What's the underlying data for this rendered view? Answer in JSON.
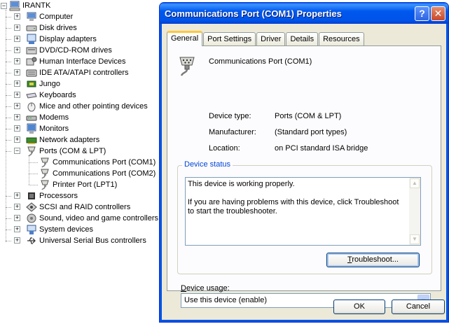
{
  "tree": {
    "root": "IRANTK",
    "items": [
      {
        "label": "Computer",
        "icon": "computer-icon"
      },
      {
        "label": "Disk drives",
        "icon": "disk-drive-icon"
      },
      {
        "label": "Display adapters",
        "icon": "display-adapter-icon"
      },
      {
        "label": "DVD/CD-ROM drives",
        "icon": "cdrom-icon"
      },
      {
        "label": "Human Interface Devices",
        "icon": "hid-icon"
      },
      {
        "label": "IDE ATA/ATAPI controllers",
        "icon": "ide-controller-icon"
      },
      {
        "label": "Jungo",
        "icon": "chip-icon"
      },
      {
        "label": "Keyboards",
        "icon": "keyboard-icon"
      },
      {
        "label": "Mice and other pointing devices",
        "icon": "mouse-icon"
      },
      {
        "label": "Modems",
        "icon": "modem-icon"
      },
      {
        "label": "Monitors",
        "icon": "monitor-icon"
      },
      {
        "label": "Network adapters",
        "icon": "network-adapter-icon"
      },
      {
        "label": "Ports (COM & LPT)",
        "icon": "port-icon",
        "expanded": true
      },
      {
        "label": "Communications Port (COM1)",
        "icon": "port-icon",
        "child": true
      },
      {
        "label": "Communications Port (COM2)",
        "icon": "port-icon",
        "child": true
      },
      {
        "label": "Printer Port (LPT1)",
        "icon": "port-icon",
        "child": true
      },
      {
        "label": "Processors",
        "icon": "processor-icon"
      },
      {
        "label": "SCSI and RAID controllers",
        "icon": "scsi-icon"
      },
      {
        "label": "Sound, video and game controllers",
        "icon": "sound-icon"
      },
      {
        "label": "System devices",
        "icon": "system-device-icon"
      },
      {
        "label": "Universal Serial Bus controllers",
        "icon": "usb-icon"
      }
    ]
  },
  "dialog": {
    "title": "Communications Port (COM1) Properties",
    "help_glyph": "?",
    "close_glyph": "✕",
    "tabs": [
      {
        "label": "General",
        "active": true
      },
      {
        "label": "Port Settings"
      },
      {
        "label": "Driver"
      },
      {
        "label": "Details"
      },
      {
        "label": "Resources"
      }
    ],
    "device_name": "Communications Port (COM1)",
    "properties": [
      {
        "label": "Device type:",
        "value": "Ports (COM & LPT)"
      },
      {
        "label": "Manufacturer:",
        "value": "(Standard port types)"
      },
      {
        "label": "Location:",
        "value": "on PCI standard ISA bridge"
      }
    ],
    "status_group_title": "Device status",
    "status_lines": [
      "This device is working properly.",
      "If you are having problems with this device, click Troubleshoot to start the troubleshooter."
    ],
    "troubleshoot": {
      "mnemonic": "T",
      "rest": "roubleshoot..."
    },
    "usage_label": {
      "mnemonic": "D",
      "rest": "evice usage:"
    },
    "usage_value": "Use this device (enable)",
    "ok_label": "OK",
    "cancel_label": "Cancel"
  },
  "colors": {
    "titlebar": "#0054e3",
    "group_title": "#0046d5",
    "dialog_bg": "#ece9d8",
    "active_tab_accent": "#ffc83c"
  }
}
